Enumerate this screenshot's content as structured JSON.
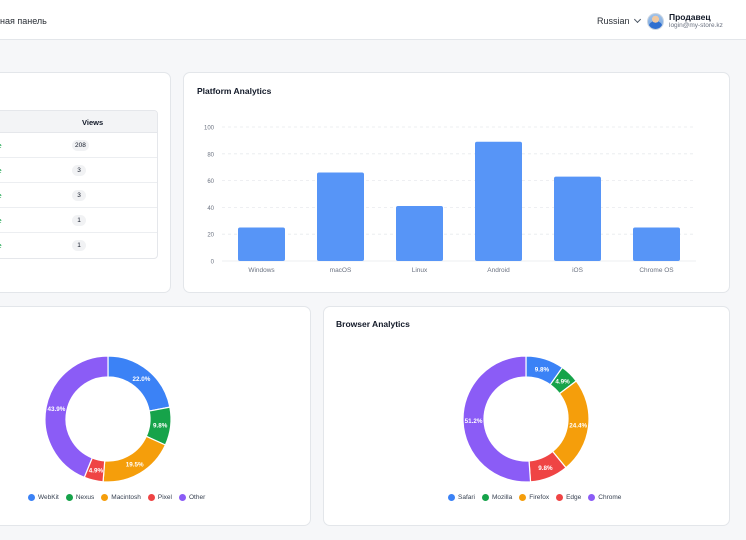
{
  "header": {
    "breadcrumb": "ная панель",
    "language": "Russian",
    "user_name": "Продавец",
    "user_email": "login@my-store.kz"
  },
  "pages_table": {
    "views_header": "Views",
    "rows": [
      {
        "page": "re",
        "views": "208"
      },
      {
        "page": "re",
        "views": "3"
      },
      {
        "page": "re",
        "views": "3"
      },
      {
        "page": "re",
        "views": "1"
      },
      {
        "page": "re",
        "views": "1"
      }
    ]
  },
  "platform": {
    "title": "Platform Analytics"
  },
  "browser": {
    "title": "Browser Analytics"
  },
  "colors": {
    "bar": "#5795f7",
    "blue": "#3b82f6",
    "green": "#16a34a",
    "orange": "#f59e0b",
    "red": "#ef4444",
    "purple": "#8b5cf6",
    "link_green": "#16a34a"
  },
  "chart_data": [
    {
      "type": "bar",
      "title": "Platform Analytics",
      "categories": [
        "Windows",
        "macOS",
        "Linux",
        "Android",
        "iOS",
        "Chrome OS"
      ],
      "values": [
        25,
        66,
        41,
        89,
        63,
        25
      ],
      "ylim": [
        0,
        100
      ],
      "yticks": [
        0,
        20,
        40,
        60,
        80,
        100
      ],
      "grid": true,
      "legend": "none"
    },
    {
      "type": "pie",
      "donut": true,
      "labels": [
        "WebKit",
        "Nexus",
        "Macintosh",
        "Pixel",
        "Other"
      ],
      "values": [
        22.0,
        9.8,
        19.5,
        4.9,
        43.9
      ],
      "value_labels": [
        "22.0%",
        "9.8%",
        "19.5%",
        "4.9%",
        "43.9%"
      ],
      "colors": [
        "#3b82f6",
        "#16a34a",
        "#f59e0b",
        "#ef4444",
        "#8b5cf6"
      ],
      "legend": "bottom"
    },
    {
      "type": "pie",
      "donut": true,
      "title": "Browser Analytics",
      "labels": [
        "Safari",
        "Mozilla",
        "Firefox",
        "Edge",
        "Chrome"
      ],
      "values": [
        9.8,
        4.9,
        24.4,
        9.8,
        51.2
      ],
      "value_labels": [
        "9.8%",
        "4.9%",
        "24.4%",
        "9.8%",
        "51.2%"
      ],
      "colors": [
        "#3b82f6",
        "#16a34a",
        "#f59e0b",
        "#ef4444",
        "#8b5cf6"
      ],
      "legend": "bottom"
    }
  ]
}
